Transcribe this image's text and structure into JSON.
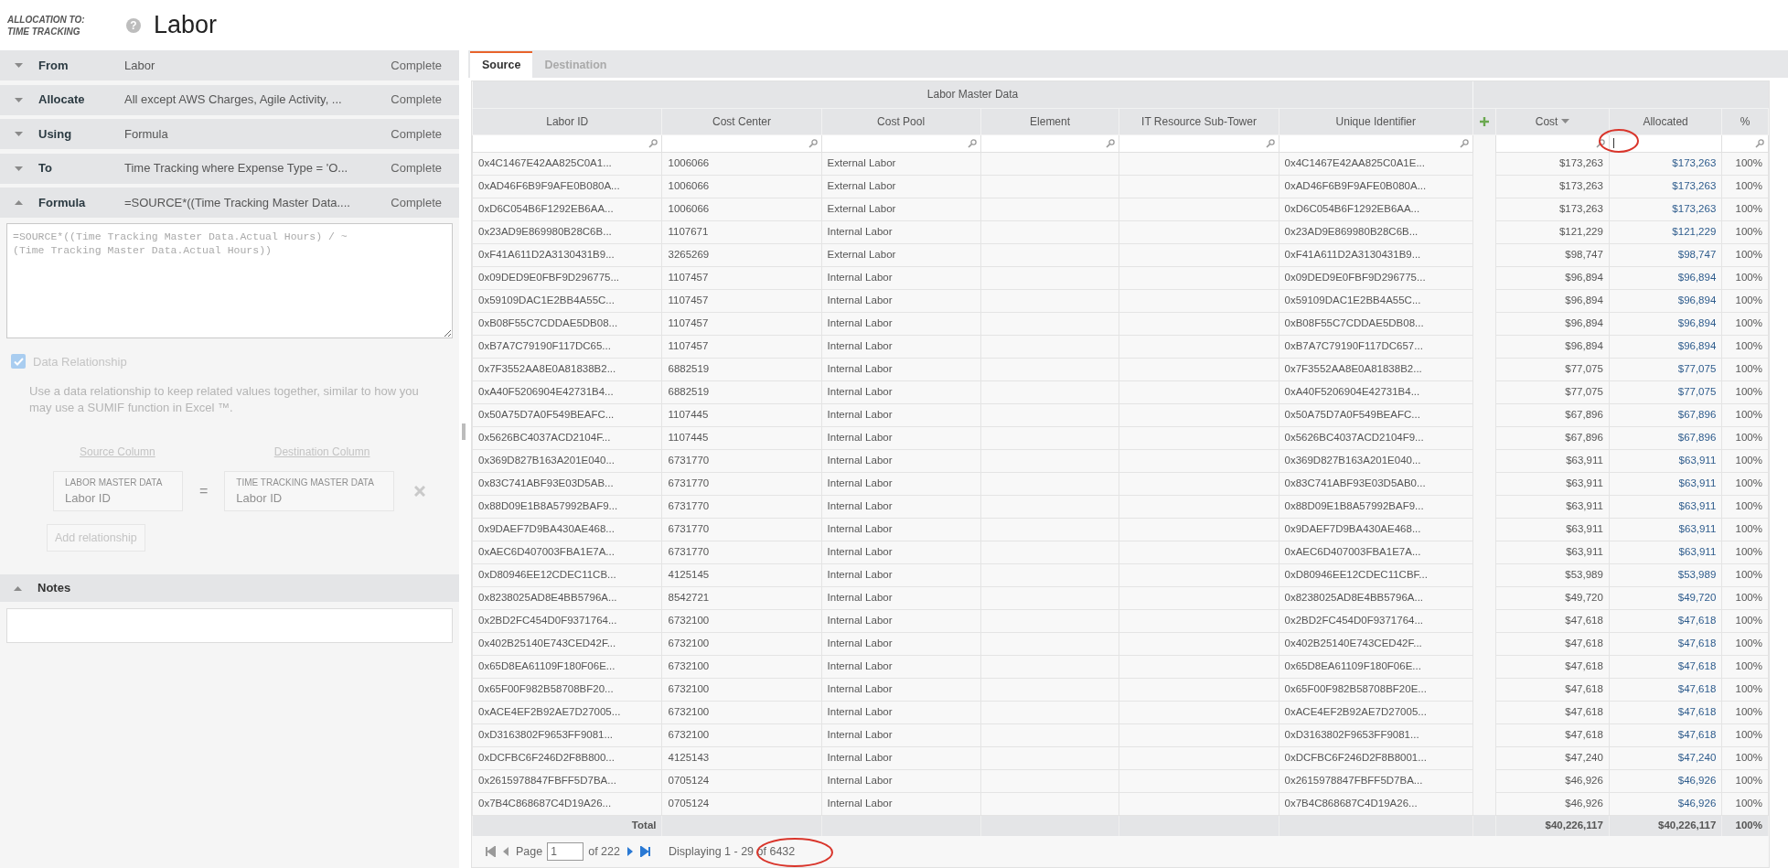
{
  "header": {
    "kicker_line_1": "ALLOCATION TO:",
    "kicker_line_2": "TIME TRACKING",
    "help_glyph": "?",
    "title": "Labor"
  },
  "sections": [
    {
      "label": "From",
      "value": "Labor",
      "status": "Complete",
      "expanded": false
    },
    {
      "label": "Allocate",
      "value": "All except AWS Charges, Agile Activity, ...",
      "status": "Complete",
      "expanded": false
    },
    {
      "label": "Using",
      "value": "Formula",
      "status": "Complete",
      "expanded": false
    },
    {
      "label": "To",
      "value": "Time Tracking where Expense Type = 'O...",
      "status": "Complete",
      "expanded": false
    },
    {
      "label": "Formula",
      "value": "=SOURCE*((Time Tracking Master Data....",
      "status": "Complete",
      "expanded": true
    }
  ],
  "formula": "=SOURCE*((Time Tracking Master Data.Actual Hours) / ~\n(Time Tracking Master Data.Actual Hours))",
  "data_relationship": {
    "label": "Data Relationship",
    "checked": true,
    "disabled": true,
    "description": "Use a data relationship to keep related values together, similar to how you may use a SUMIF function in Excel ™.",
    "source_column_label": "Source Column",
    "destination_column_label": "Destination Column",
    "source_table": "LABOR MASTER DATA",
    "source_field": "Labor ID",
    "equals": "=",
    "destination_table": "TIME TRACKING MASTER DATA",
    "destination_field": "Labor ID",
    "add_button": "Add relationship"
  },
  "notes": {
    "label": "Notes",
    "expanded": true
  },
  "tabs": [
    {
      "label": "Source",
      "selected": true
    },
    {
      "label": "Destination",
      "selected": false
    }
  ],
  "table": {
    "column_groups": [
      {
        "label": "Labor Master Data",
        "columns": [
          {
            "label": "Labor ID",
            "kind": "text",
            "sorted_descending": false,
            "filter_focused": false
          },
          {
            "label": "Cost Center",
            "kind": "text",
            "sorted_descending": false,
            "filter_focused": false
          },
          {
            "label": "Cost Pool",
            "kind": "text",
            "sorted_descending": false,
            "filter_focused": false
          },
          {
            "label": "Element",
            "kind": "text",
            "sorted_descending": false,
            "filter_focused": false
          },
          {
            "label": "IT Resource Sub-Tower",
            "kind": "text",
            "sorted_descending": false,
            "filter_focused": false
          },
          {
            "label": "Unique Identifier",
            "kind": "text",
            "sorted_descending": false,
            "filter_focused": false
          }
        ]
      },
      {
        "columns": [
          {
            "label": "Cost",
            "kind": "money",
            "sorted_descending": true,
            "filter_focused": false
          },
          {
            "label": "Allocated",
            "kind": "allocated",
            "sorted_descending": false,
            "filter_focused": true
          },
          {
            "label": "%",
            "kind": "percent",
            "sorted_descending": false,
            "filter_focused": false
          }
        ]
      }
    ],
    "rows": [
      [
        "0x4C1467E42AA825C0A1...",
        "1006066",
        "External Labor",
        null,
        null,
        "0x4C1467E42AA825C0A1E...",
        "$173,263",
        "$173,263",
        "100%"
      ],
      [
        "0xAD46F6B9F9AFE0B080A...",
        "1006066",
        "External Labor",
        null,
        null,
        "0xAD46F6B9F9AFE0B080A...",
        "$173,263",
        "$173,263",
        "100%"
      ],
      [
        "0xD6C054B6F1292EB6AA...",
        "1006066",
        "External Labor",
        null,
        null,
        "0xD6C054B6F1292EB6AA...",
        "$173,263",
        "$173,263",
        "100%"
      ],
      [
        "0x23AD9E869980B28C6B...",
        "1107671",
        "Internal Labor",
        null,
        null,
        "0x23AD9E869980B28C6B...",
        "$121,229",
        "$121,229",
        "100%"
      ],
      [
        "0xF41A611D2A3130431B9...",
        "3265269",
        "External Labor",
        null,
        null,
        "0xF41A611D2A3130431B9...",
        "$98,747",
        "$98,747",
        "100%"
      ],
      [
        "0x09DED9E0FBF9D296775...",
        "1107457",
        "Internal Labor",
        null,
        null,
        "0x09DED9E0FBF9D296775...",
        "$96,894",
        "$96,894",
        "100%"
      ],
      [
        "0x59109DAC1E2BB4A55C...",
        "1107457",
        "Internal Labor",
        null,
        null,
        "0x59109DAC1E2BB4A55C...",
        "$96,894",
        "$96,894",
        "100%"
      ],
      [
        "0xB08F55C7CDDAE5DB08...",
        "1107457",
        "Internal Labor",
        null,
        null,
        "0xB08F55C7CDDAE5DB08...",
        "$96,894",
        "$96,894",
        "100%"
      ],
      [
        "0xB7A7C79190F117DC65...",
        "1107457",
        "Internal Labor",
        null,
        null,
        "0xB7A7C79190F117DC657...",
        "$96,894",
        "$96,894",
        "100%"
      ],
      [
        "0x7F3552AA8E0A81838B2...",
        "6882519",
        "Internal Labor",
        null,
        null,
        "0x7F3552AA8E0A81838B2...",
        "$77,075",
        "$77,075",
        "100%"
      ],
      [
        "0xA40F5206904E42731B4...",
        "6882519",
        "Internal Labor",
        null,
        null,
        "0xA40F5206904E42731B4...",
        "$77,075",
        "$77,075",
        "100%"
      ],
      [
        "0x50A75D7A0F549BEAFC...",
        "1107445",
        "Internal Labor",
        null,
        null,
        "0x50A75D7A0F549BEAFC...",
        "$67,896",
        "$67,896",
        "100%"
      ],
      [
        "0x5626BC4037ACD2104F...",
        "1107445",
        "Internal Labor",
        null,
        null,
        "0x5626BC4037ACD2104F9...",
        "$67,896",
        "$67,896",
        "100%"
      ],
      [
        "0x369D827B163A201E040...",
        "6731770",
        "Internal Labor",
        null,
        null,
        "0x369D827B163A201E040...",
        "$63,911",
        "$63,911",
        "100%"
      ],
      [
        "0x83C741ABF93E03D5AB...",
        "6731770",
        "Internal Labor",
        null,
        null,
        "0x83C741ABF93E03D5AB0...",
        "$63,911",
        "$63,911",
        "100%"
      ],
      [
        "0x88D09E1B8A57992BAF9...",
        "6731770",
        "Internal Labor",
        null,
        null,
        "0x88D09E1B8A57992BAF9...",
        "$63,911",
        "$63,911",
        "100%"
      ],
      [
        "0x9DAEF7D9BA430AE468...",
        "6731770",
        "Internal Labor",
        null,
        null,
        "0x9DAEF7D9BA430AE468...",
        "$63,911",
        "$63,911",
        "100%"
      ],
      [
        "0xAEC6D407003FBA1E7A...",
        "6731770",
        "Internal Labor",
        null,
        null,
        "0xAEC6D407003FBA1E7A...",
        "$63,911",
        "$63,911",
        "100%"
      ],
      [
        "0xD80946EE12CDEC11CB...",
        "4125145",
        "Internal Labor",
        null,
        null,
        "0xD80946EE12CDEC11CBF...",
        "$53,989",
        "$53,989",
        "100%"
      ],
      [
        "0x8238025AD8E4BB5796A...",
        "8542721",
        "Internal Labor",
        null,
        null,
        "0x8238025AD8E4BB5796A...",
        "$49,720",
        "$49,720",
        "100%"
      ],
      [
        "0x2BD2FC454D0F9371764...",
        "6732100",
        "Internal Labor",
        null,
        null,
        "0x2BD2FC454D0F9371764...",
        "$47,618",
        "$47,618",
        "100%"
      ],
      [
        "0x402B25140E743CED42F...",
        "6732100",
        "Internal Labor",
        null,
        null,
        "0x402B25140E743CED42F...",
        "$47,618",
        "$47,618",
        "100%"
      ],
      [
        "0x65D8EA61109F180F06E...",
        "6732100",
        "Internal Labor",
        null,
        null,
        "0x65D8EA61109F180F06E...",
        "$47,618",
        "$47,618",
        "100%"
      ],
      [
        "0x65F00F982B58708BF20...",
        "6732100",
        "Internal Labor",
        null,
        null,
        "0x65F00F982B58708BF20E...",
        "$47,618",
        "$47,618",
        "100%"
      ],
      [
        "0xACE4EF2B92AE7D27005...",
        "6732100",
        "Internal Labor",
        null,
        null,
        "0xACE4EF2B92AE7D27005...",
        "$47,618",
        "$47,618",
        "100%"
      ],
      [
        "0xD3163802F9653FF9081...",
        "6732100",
        "Internal Labor",
        null,
        null,
        "0xD3163802F9653FF9081...",
        "$47,618",
        "$47,618",
        "100%"
      ],
      [
        "0xDCFBC6F246D2F8B800...",
        "4125143",
        "Internal Labor",
        null,
        null,
        "0xDCFBC6F246D2F8B8001...",
        "$47,240",
        "$47,240",
        "100%"
      ],
      [
        "0x2615978847FBFF5D7BA...",
        "0705124",
        "Internal Labor",
        null,
        null,
        "0x2615978847FBFF5D7BA...",
        "$46,926",
        "$46,926",
        "100%"
      ],
      [
        "0x7B4C868687C4D19A26...",
        "0705124",
        "Internal Labor",
        null,
        null,
        "0x7B4C868687C4D19A26...",
        "$46,926",
        "$46,926",
        "100%"
      ]
    ],
    "totals": {
      "label": "Total",
      "values": [
        "$40,226,117",
        "$40,226,117",
        "100%"
      ]
    }
  },
  "pager": {
    "buttons": [
      {
        "kind": "first",
        "disabled": true
      },
      {
        "kind": "prev",
        "disabled": true
      },
      {
        "kind": "next",
        "disabled": false
      },
      {
        "kind": "last",
        "disabled": false
      }
    ],
    "page_label": "Page",
    "page": "1",
    "of_pages": "of 222",
    "display": "Displaying 1 - 29 of 6432"
  }
}
